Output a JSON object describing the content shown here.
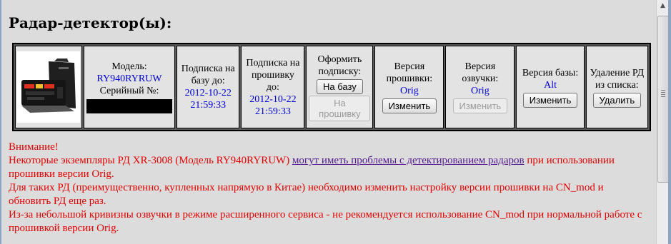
{
  "section_title": "Радар-детектор(ы):",
  "table": {
    "model_label": "Модель:",
    "model_value": "RY940RYRUW",
    "serial_label": "Серийный №:",
    "sub_db_label": "Подписка на базу до:",
    "sub_db_date": "2012-10-22",
    "sub_db_time": "21:59:33",
    "sub_fw_label": "Подписка на прошивку до:",
    "sub_fw_date": "2012-10-22",
    "sub_fw_time": "21:59:33",
    "order_label": "Оформить подписку:",
    "order_db_button": "На базу",
    "order_fw_button": "На прошивку",
    "fw_version_label": "Версия прошивки:",
    "fw_version_value": "Orig",
    "fw_change_button": "Изменить",
    "voice_version_label": "Версия озвучки:",
    "voice_version_value": "Orig",
    "voice_change_button": "Изменить",
    "db_version_label": "Версия базы:",
    "db_version_value": "Alt",
    "db_change_button": "Изменить",
    "remove_label": "Удаление РД из списка:",
    "remove_button": "Удалить"
  },
  "warning": {
    "title": "Внимание!",
    "line1_a": "Некоторые экземпляры РД XR-3008 (Модель RY940RYRUW) ",
    "line1_link": "могут иметь проблемы с детектированием радаров",
    "line1_b": " при использовании прошивки версии Orig.",
    "line2": "Для таких РД (преимущественно, купленных напрямую в Китае) необходимо изменить настройку версии прошивки на CN_mod и обновить РД еще раз.",
    "line3": "Из-за небольшой кривизны озвучки в режиме расширенного сервиса - не рекомендуется использование CN_mod при нормальной работе с прошивкой версии Orig."
  }
}
